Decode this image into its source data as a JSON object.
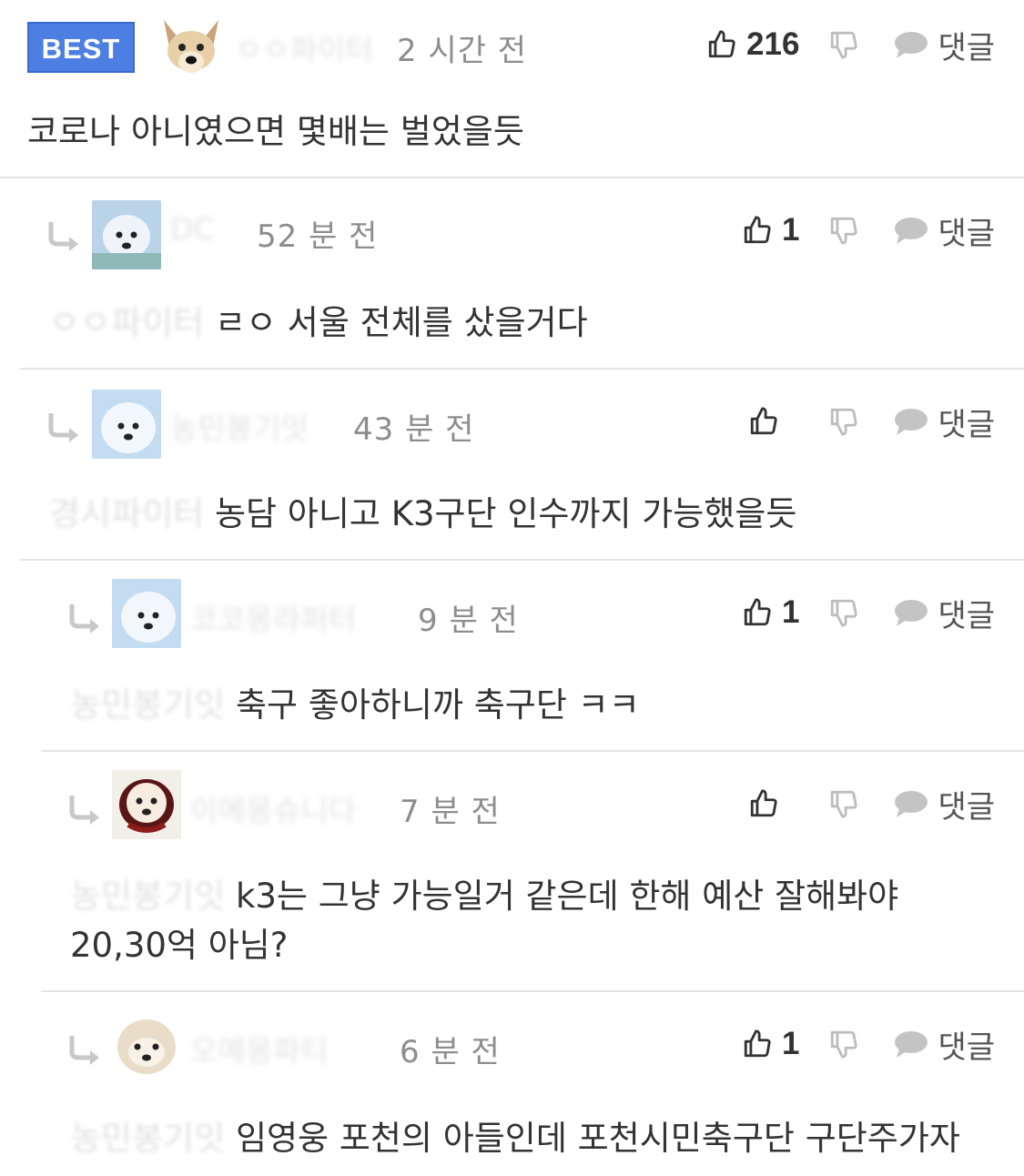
{
  "badge": {
    "best_label": "BEST"
  },
  "comments": [
    {
      "nickname": "ㅇㅇ파이터",
      "time": "2 시간 전",
      "likes": "216",
      "mention": "",
      "text": "코로나 아니였으면 몇배는 벌었을듯",
      "text2": ""
    },
    {
      "nickname": "DC",
      "time": "52 분 전",
      "likes": "1",
      "mention": "ㅇㅇ파이터",
      "text": "ㄹㅇ 서울 전체를 샀을거다",
      "text2": ""
    },
    {
      "nickname": "농민봉기잇",
      "time": "43 분 전",
      "likes": "",
      "mention": "경시파이터",
      "text": "농담 아니고 K3구단 인수까지 가능했을듯",
      "text2": ""
    },
    {
      "nickname": "코코몽라퍼터",
      "time": "9 분 전",
      "likes": "1",
      "mention": "농민봉기잇",
      "text": "축구 좋아하니까 축구단 ㅋㅋ",
      "text2": ""
    },
    {
      "nickname": "이에몽슈니다",
      "time": "7 분 전",
      "likes": "",
      "mention": "농민봉기잇",
      "text": "k3는 그냥 가능일거 같은데 한해 예산 잘해봐야",
      "text2": "20,30억 아님?"
    },
    {
      "nickname": "오예몽파티",
      "time": "6 분 전",
      "likes": "1",
      "mention": "농민봉기잇",
      "text": "임영웅 포천의 아들인데 포천시민축구단 구단주가자",
      "text2": ""
    }
  ],
  "labels": {
    "reply": "댓글"
  },
  "icons": {
    "like": "thumbs-up-icon",
    "dislike": "thumbs-down-icon",
    "reply": "speech-bubble-icon",
    "reply_arrow": "reply-arrow-icon"
  },
  "colors": {
    "best_badge": "#4d7fe3",
    "divider": "#e4e4e4",
    "time": "#8d8d8d",
    "icon": "#333333",
    "icon_muted": "#bdbdbd"
  }
}
